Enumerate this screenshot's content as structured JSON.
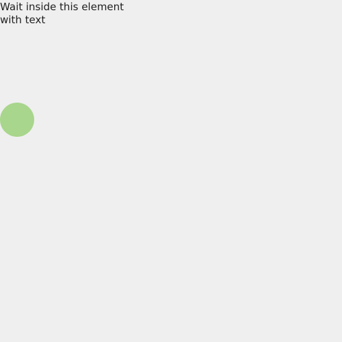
{
  "instruction": {
    "text": "Wait inside this element with text"
  },
  "indicator": {
    "color": "#a8d68c",
    "icon": "circle"
  }
}
